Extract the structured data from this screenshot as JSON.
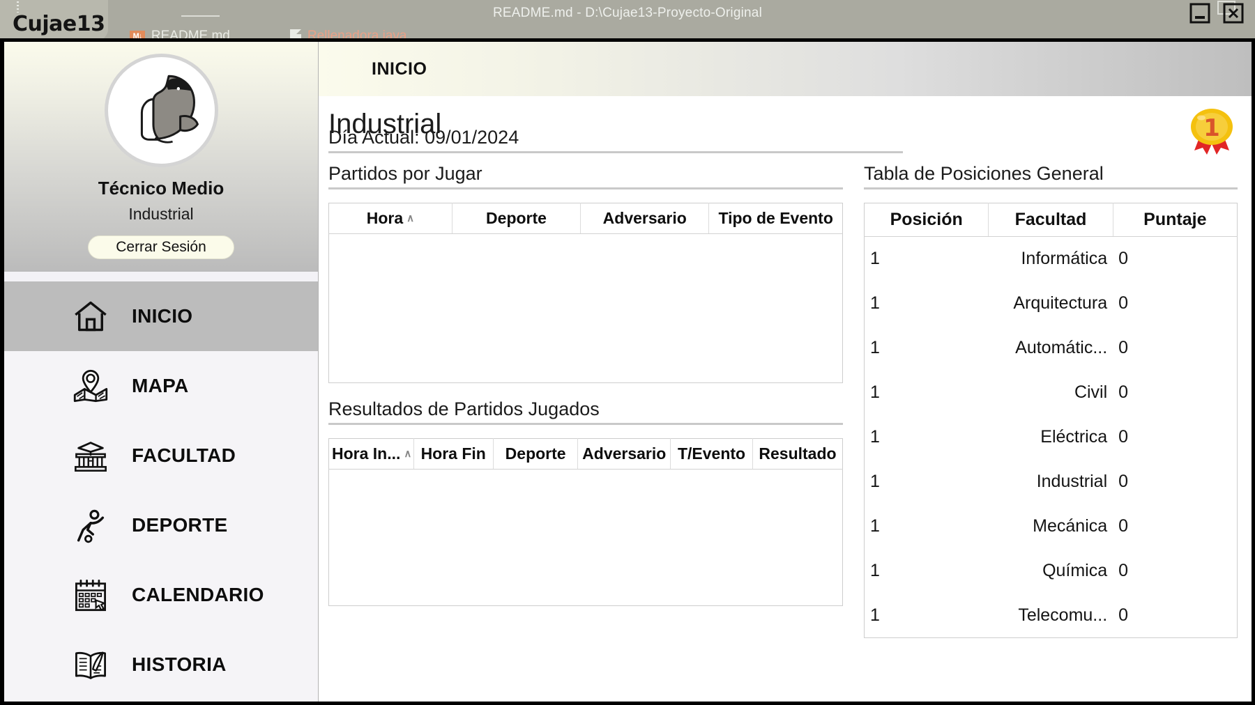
{
  "background_ide": {
    "window_title": "README.md - D:\\Cujae13-Proyecto-Original",
    "logo_text": "Cujae13",
    "tabs": [
      {
        "label": "README.md",
        "icon": "none",
        "close": "×"
      },
      {
        "label": "README.md",
        "icon": "markdown-icon",
        "close": ""
      },
      {
        "label": "Rellenadora.java",
        "icon": "java-file-icon",
        "close": ""
      }
    ],
    "window_controls": {
      "minimize": "minimize-icon",
      "close": "close-icon"
    }
  },
  "sidebar": {
    "avatar_icon": "dolphin-logo",
    "user_name": "Técnico Medio",
    "user_faculty": "Industrial",
    "logout_label": "Cerrar Sesión",
    "items": [
      {
        "label": "INICIO",
        "icon": "home-icon",
        "active": true
      },
      {
        "label": "MAPA",
        "icon": "map-icon",
        "active": false
      },
      {
        "label": "FACULTAD",
        "icon": "university-icon",
        "active": false
      },
      {
        "label": "DEPORTE",
        "icon": "sports-icon",
        "active": false
      },
      {
        "label": "CALENDARIO",
        "icon": "calendar-icon",
        "active": false
      },
      {
        "label": "HISTORIA",
        "icon": "book-quill-icon",
        "active": false
      }
    ]
  },
  "main": {
    "header_title": "INICIO",
    "page_title": "Industrial",
    "medal_icon": "first-place-medal",
    "medal_number": "1",
    "current_day_label": "Día Actual: 09/01/2024",
    "upcoming": {
      "title": "Partidos por Jugar",
      "columns": [
        "Hora",
        "Deporte",
        "Adversario",
        "Tipo de Evento"
      ],
      "sorted_column": "Hora",
      "sort_caret": "∧",
      "rows": []
    },
    "results": {
      "title": "Resultados de Partidos Jugados",
      "columns": [
        "Hora In...",
        "Hora Fin",
        "Deporte",
        "Adversario",
        "T/Evento",
        "Resultado"
      ],
      "sorted_column": "Hora In...",
      "sort_caret": "∧",
      "rows": []
    },
    "standings": {
      "title": "Tabla de Posiciones General",
      "columns": [
        "Posición",
        "Facultad",
        "Puntaje"
      ],
      "rows": [
        {
          "posicion": "1",
          "facultad": "Informática",
          "puntaje": "0"
        },
        {
          "posicion": "1",
          "facultad": "Arquitectura",
          "puntaje": "0"
        },
        {
          "posicion": "1",
          "facultad": "Automátic...",
          "puntaje": "0"
        },
        {
          "posicion": "1",
          "facultad": "Civil",
          "puntaje": "0"
        },
        {
          "posicion": "1",
          "facultad": "Eléctrica",
          "puntaje": "0"
        },
        {
          "posicion": "1",
          "facultad": "Industrial",
          "puntaje": "0"
        },
        {
          "posicion": "1",
          "facultad": "Mecánica",
          "puntaje": "0"
        },
        {
          "posicion": "1",
          "facultad": "Química",
          "puntaje": "0"
        },
        {
          "posicion": "1",
          "facultad": "Telecomu...",
          "puntaje": "0"
        }
      ]
    }
  },
  "colors": {
    "sidebar_active": "#bcbcbc",
    "header_gradient_start": "#fbfbec",
    "header_gradient_end": "#bebebe",
    "logout_button": "#fbfbea",
    "medal_gold": "#f4c10f",
    "medal_ribbon": "#e02727",
    "window_border": "#000000"
  }
}
